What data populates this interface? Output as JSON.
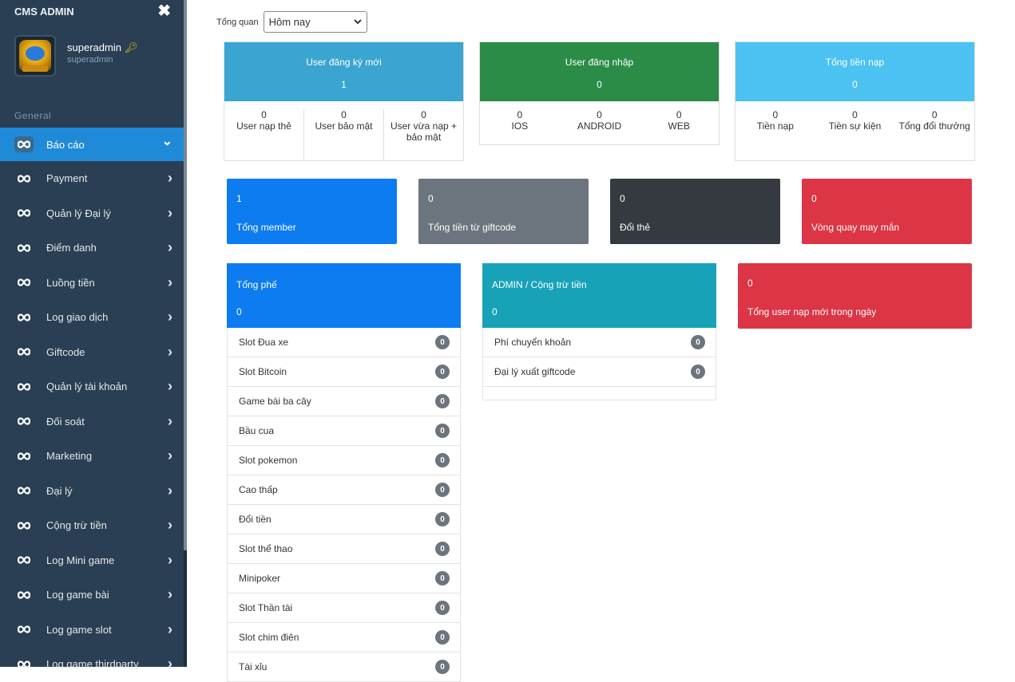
{
  "sidebar": {
    "brand": "CMS ADMIN",
    "close_icon": "✖",
    "user": {
      "name": "superadmin",
      "role": "superadmin"
    },
    "section": "General",
    "items": [
      {
        "label": "Báo cáo",
        "active": true
      },
      {
        "label": "Payment"
      },
      {
        "label": "Quản lý Đại lý"
      },
      {
        "label": "Điểm danh"
      },
      {
        "label": "Luồng tiền"
      },
      {
        "label": "Log giao dịch"
      },
      {
        "label": "Giftcode"
      },
      {
        "label": "Quản lý tài khoản"
      },
      {
        "label": "Đối soát"
      },
      {
        "label": "Marketing"
      },
      {
        "label": "Đại lý"
      },
      {
        "label": "Cộng trừ tiền"
      },
      {
        "label": "Log Mini game"
      },
      {
        "label": "Log game bài"
      },
      {
        "label": "Log game slot"
      },
      {
        "label": "Log game thirdparty"
      }
    ]
  },
  "overview": {
    "label": "Tổng quan",
    "selected": "Hôm nay"
  },
  "stats": [
    {
      "title": "User đăng ký mới",
      "value": "1",
      "color": "#3aa5d0",
      "cells": [
        {
          "v": "0",
          "l": "User nạp thẻ"
        },
        {
          "v": "0",
          "l": "User bảo mật"
        },
        {
          "v": "0",
          "l": "User vừa nạp + bảo mật"
        }
      ]
    },
    {
      "title": "User đăng nhập",
      "value": "0",
      "color": "#2a8c47",
      "cells": [
        {
          "v": "0",
          "l": "IOS"
        },
        {
          "v": "0",
          "l": "ANDROID"
        },
        {
          "v": "0",
          "l": "WEB"
        }
      ]
    },
    {
      "title": "Tổng tiền nạp",
      "value": "0",
      "color": "#4bc2f2",
      "cells": [
        {
          "v": "0",
          "l": "Tiền nạp"
        },
        {
          "v": "0",
          "l": "Tiền sự kiện"
        },
        {
          "v": "0",
          "l": "Tổng đổi thưởng"
        }
      ]
    }
  ],
  "boxes": [
    {
      "value": "1",
      "label": "Tổng member",
      "color": "#0d7cf0"
    },
    {
      "value": "0",
      "label": "Tổng tiền từ giftcode",
      "color": "#6c757d"
    },
    {
      "value": "0",
      "label": "Đổi thẻ",
      "color": "#343a40"
    },
    {
      "value": "0",
      "label": "Vòng quay may mắn",
      "color": "#dc3545"
    }
  ],
  "fee_panel": {
    "title": "Tổng phế",
    "value": "0",
    "color": "#0d7cf0",
    "rows": [
      {
        "label": "Slot Đua xe",
        "count": "0"
      },
      {
        "label": "Slot Bitcoin",
        "count": "0"
      },
      {
        "label": "Game bài ba cây",
        "count": "0"
      },
      {
        "label": "Bầu cua",
        "count": "0"
      },
      {
        "label": "Slot pokemon",
        "count": "0"
      },
      {
        "label": "Cao thấp",
        "count": "0"
      },
      {
        "label": "Đổi tiền",
        "count": "0"
      },
      {
        "label": "Slot thể thao",
        "count": "0"
      },
      {
        "label": "Minipoker",
        "count": "0"
      },
      {
        "label": "Slot Thần tài",
        "count": "0"
      },
      {
        "label": "Slot chim điên",
        "count": "0"
      },
      {
        "label": "Tài xỉu",
        "count": "0"
      }
    ]
  },
  "admin_panel": {
    "title": "ADMIN / Cộng trừ tiền",
    "value": "0",
    "color": "#17a2b8",
    "rows": [
      {
        "label": "Phí chuyển khoản",
        "count": "0"
      },
      {
        "label": "Đại lý xuất giftcode",
        "count": "0"
      }
    ]
  },
  "new_user_box": {
    "value": "0",
    "label": "Tổng user nạp mới trong ngày",
    "color": "#dc3545"
  }
}
